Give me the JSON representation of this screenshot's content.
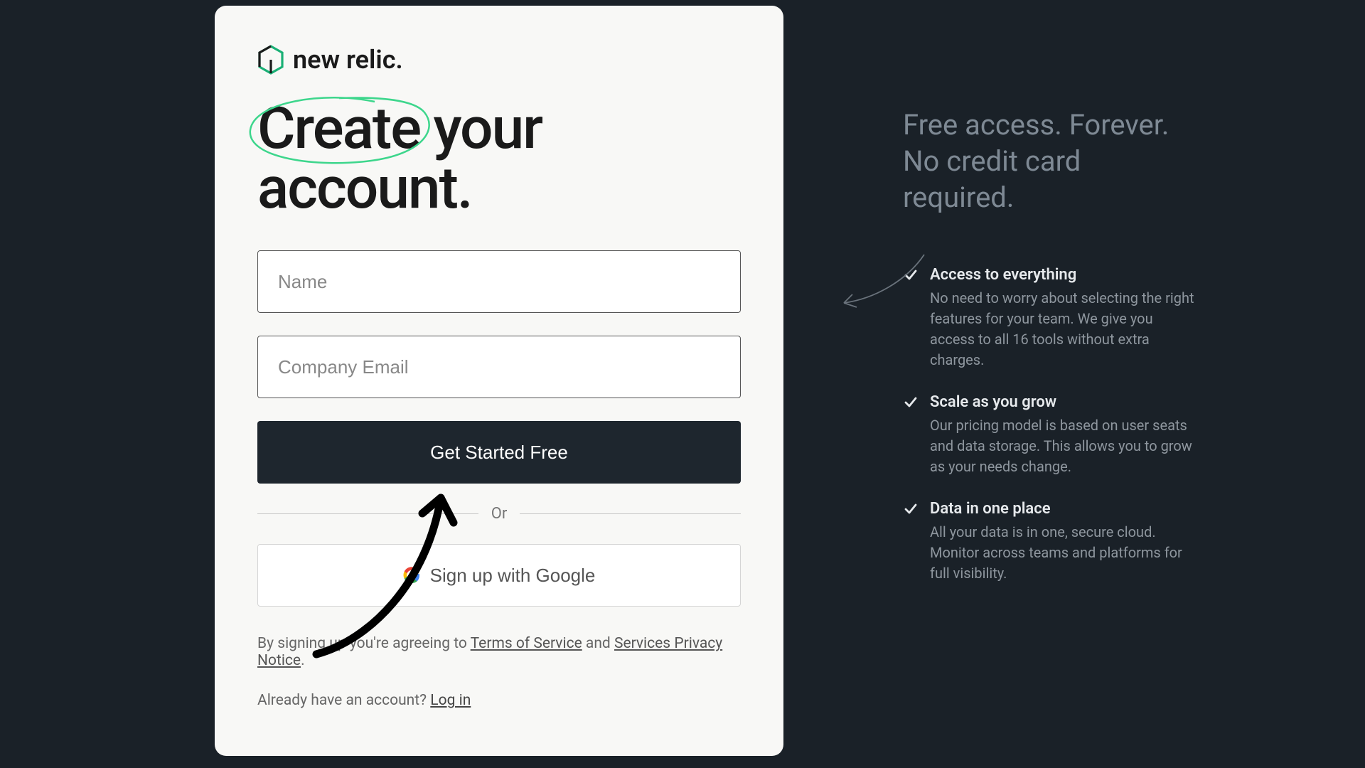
{
  "logo_text": "new relic.",
  "heading": "Create your account.",
  "fields": {
    "name_placeholder": "Name",
    "email_placeholder": "Company Email"
  },
  "primary_button": "Get Started Free",
  "divider": "Or",
  "google_button": "Sign up with Google",
  "legal": {
    "prefix": "By signing up you're agreeing to ",
    "tos": "Terms of Service",
    "mid": " and ",
    "privacy": "Services Privacy Notice",
    "suffix": "."
  },
  "login": {
    "prompt": "Already have an account? ",
    "link": "Log in"
  },
  "side": {
    "headline": "Free access. Forever.\nNo credit card required.",
    "benefits": [
      {
        "title": "Access to everything",
        "desc": "No need to worry about selecting the right features for your team. We give you access to all 16 tools without extra charges."
      },
      {
        "title": "Scale as you grow",
        "desc": "Our pricing model is based on user seats and data storage. This allows you to grow as your needs change."
      },
      {
        "title": "Data in one place",
        "desc": "All your data is in one, secure cloud. Monitor across teams and platforms for full visibility."
      }
    ]
  }
}
